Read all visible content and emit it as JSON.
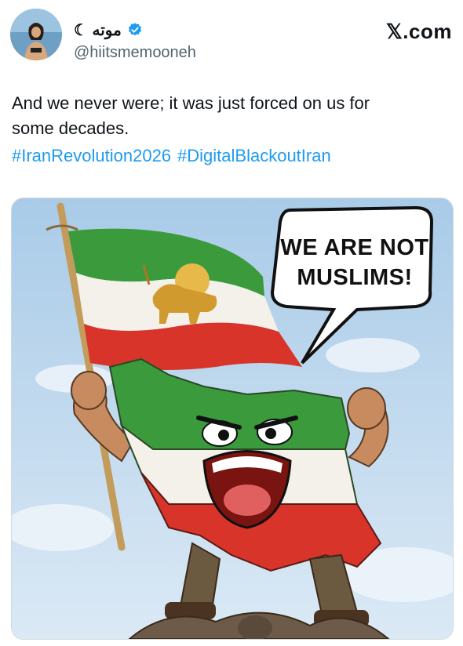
{
  "header": {
    "display_name": "موته ☾",
    "handle": "@hiitsmemooneh",
    "brand": "𝕏.com"
  },
  "tweet": {
    "text_line1": "And we never were; it was just forced on us for",
    "text_line2": "some decades.",
    "hashtags": [
      "#IranRevolution2026",
      "#DigitalBlackoutIran"
    ]
  },
  "media": {
    "bubble_line1": "WE ARE NOT",
    "bubble_line2": "MUSLIMS!"
  },
  "colors": {
    "link": "#1d9bf0",
    "verified": "#1d9bf0",
    "flag_green": "#3a9a3c",
    "flag_red": "#d8342a",
    "sky": "#b9d6ee"
  }
}
